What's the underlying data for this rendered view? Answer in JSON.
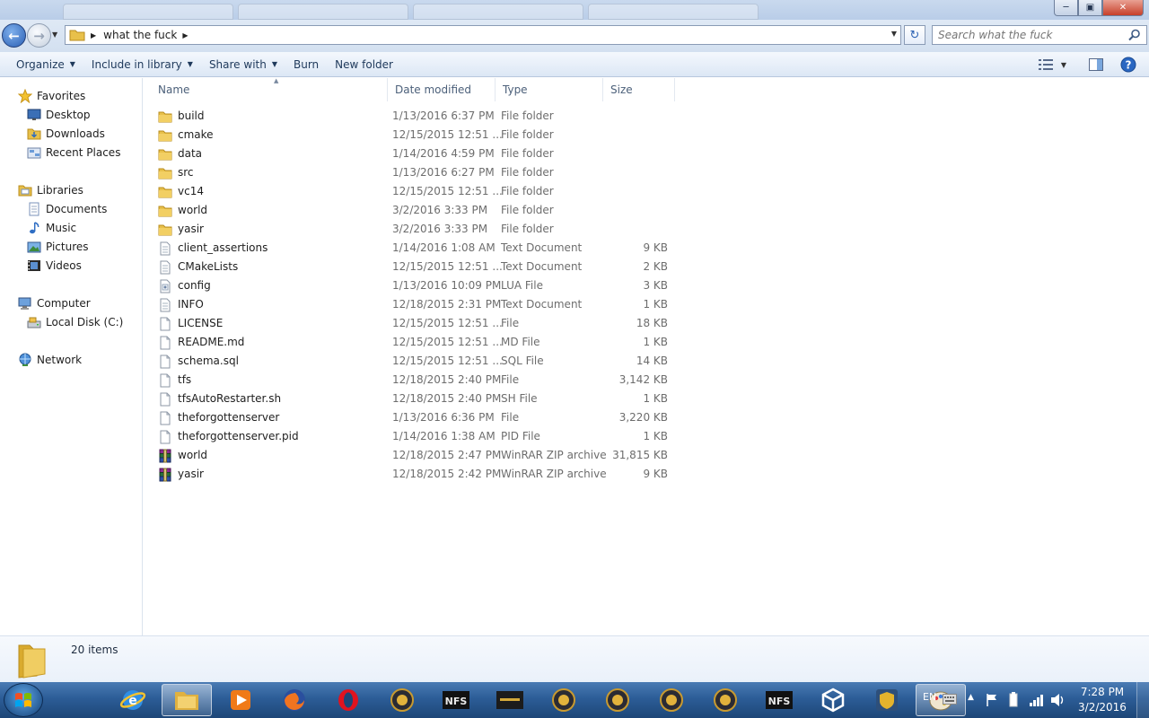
{
  "address": {
    "crumbs": [
      "what the fuck"
    ]
  },
  "search": {
    "placeholder": "Search what the fuck"
  },
  "toolbar": {
    "organize": "Organize",
    "include_in_library": "Include in library",
    "share_with": "Share with",
    "burn": "Burn",
    "new_folder": "New folder"
  },
  "nav": {
    "favorites": "Favorites",
    "desktop": "Desktop",
    "downloads": "Downloads",
    "recent_places": "Recent Places",
    "libraries": "Libraries",
    "documents": "Documents",
    "music": "Music",
    "pictures": "Pictures",
    "videos": "Videos",
    "computer": "Computer",
    "local_disk": "Local Disk (C:)",
    "network": "Network"
  },
  "columns": {
    "name": "Name",
    "date": "Date modified",
    "type": "Type",
    "size": "Size"
  },
  "files": [
    {
      "name": "build",
      "date": "1/13/2016 6:37 PM",
      "type": "File folder",
      "size": "",
      "icon": "folder-icon"
    },
    {
      "name": "cmake",
      "date": "12/15/2015 12:51 ...",
      "type": "File folder",
      "size": "",
      "icon": "folder-icon"
    },
    {
      "name": "data",
      "date": "1/14/2016 4:59 PM",
      "type": "File folder",
      "size": "",
      "icon": "folder-icon"
    },
    {
      "name": "src",
      "date": "1/13/2016 6:27 PM",
      "type": "File folder",
      "size": "",
      "icon": "folder-icon"
    },
    {
      "name": "vc14",
      "date": "12/15/2015 12:51 ...",
      "type": "File folder",
      "size": "",
      "icon": "folder-icon"
    },
    {
      "name": "world",
      "date": "3/2/2016 3:33 PM",
      "type": "File folder",
      "size": "",
      "icon": "folder-icon"
    },
    {
      "name": "yasir",
      "date": "3/2/2016 3:33 PM",
      "type": "File folder",
      "size": "",
      "icon": "folder-icon"
    },
    {
      "name": "client_assertions",
      "date": "1/14/2016 1:08 AM",
      "type": "Text Document",
      "size": "9 KB",
      "icon": "text-file-icon"
    },
    {
      "name": "CMakeLists",
      "date": "12/15/2015 12:51 ...",
      "type": "Text Document",
      "size": "2 KB",
      "icon": "text-file-icon"
    },
    {
      "name": "config",
      "date": "1/13/2016 10:09 PM",
      "type": "LUA File",
      "size": "3 KB",
      "icon": "lua-file-icon"
    },
    {
      "name": "INFO",
      "date": "12/18/2015 2:31 PM",
      "type": "Text Document",
      "size": "1 KB",
      "icon": "text-file-icon"
    },
    {
      "name": "LICENSE",
      "date": "12/15/2015 12:51 ...",
      "type": "File",
      "size": "18 KB",
      "icon": "file-icon"
    },
    {
      "name": "README.md",
      "date": "12/15/2015 12:51 ...",
      "type": "MD File",
      "size": "1 KB",
      "icon": "file-icon"
    },
    {
      "name": "schema.sql",
      "date": "12/15/2015 12:51 ...",
      "type": "SQL File",
      "size": "14 KB",
      "icon": "file-icon"
    },
    {
      "name": "tfs",
      "date": "12/18/2015 2:40 PM",
      "type": "File",
      "size": "3,142 KB",
      "icon": "file-icon"
    },
    {
      "name": "tfsAutoRestarter.sh",
      "date": "12/18/2015 2:40 PM",
      "type": "SH File",
      "size": "1 KB",
      "icon": "file-icon"
    },
    {
      "name": "theforgottenserver",
      "date": "1/13/2016 6:36 PM",
      "type": "File",
      "size": "3,220 KB",
      "icon": "file-icon"
    },
    {
      "name": "theforgottenserver.pid",
      "date": "1/14/2016 1:38 AM",
      "type": "PID File",
      "size": "1 KB",
      "icon": "file-icon"
    },
    {
      "name": "world",
      "date": "12/18/2015 2:47 PM",
      "type": "WinRAR ZIP archive",
      "size": "31,815 KB",
      "icon": "winrar-archive-icon"
    },
    {
      "name": "yasir",
      "date": "12/18/2015 2:42 PM",
      "type": "WinRAR ZIP archive",
      "size": "9 KB",
      "icon": "winrar-archive-icon"
    }
  ],
  "details": {
    "count": "20 items"
  },
  "tray": {
    "lang": "EN",
    "time": "7:28 PM",
    "date": "3/2/2016"
  },
  "taskbar_apps": [
    "internet-explorer-icon",
    "file-explorer-icon",
    "media-player-icon",
    "firefox-icon",
    "opera-icon",
    "game-app-icon",
    "nfs-game-icon",
    "counter-strike-icon",
    "game-app-icon",
    "game-app-icon",
    "game-app-icon",
    "game-app-icon",
    "nfs-game-icon",
    "unity-icon",
    "shield-app-icon",
    "paint-icon"
  ],
  "colors": {
    "folder": "#e8c04a",
    "accent": "#1e395b",
    "taskbar": "#2c5d97"
  }
}
